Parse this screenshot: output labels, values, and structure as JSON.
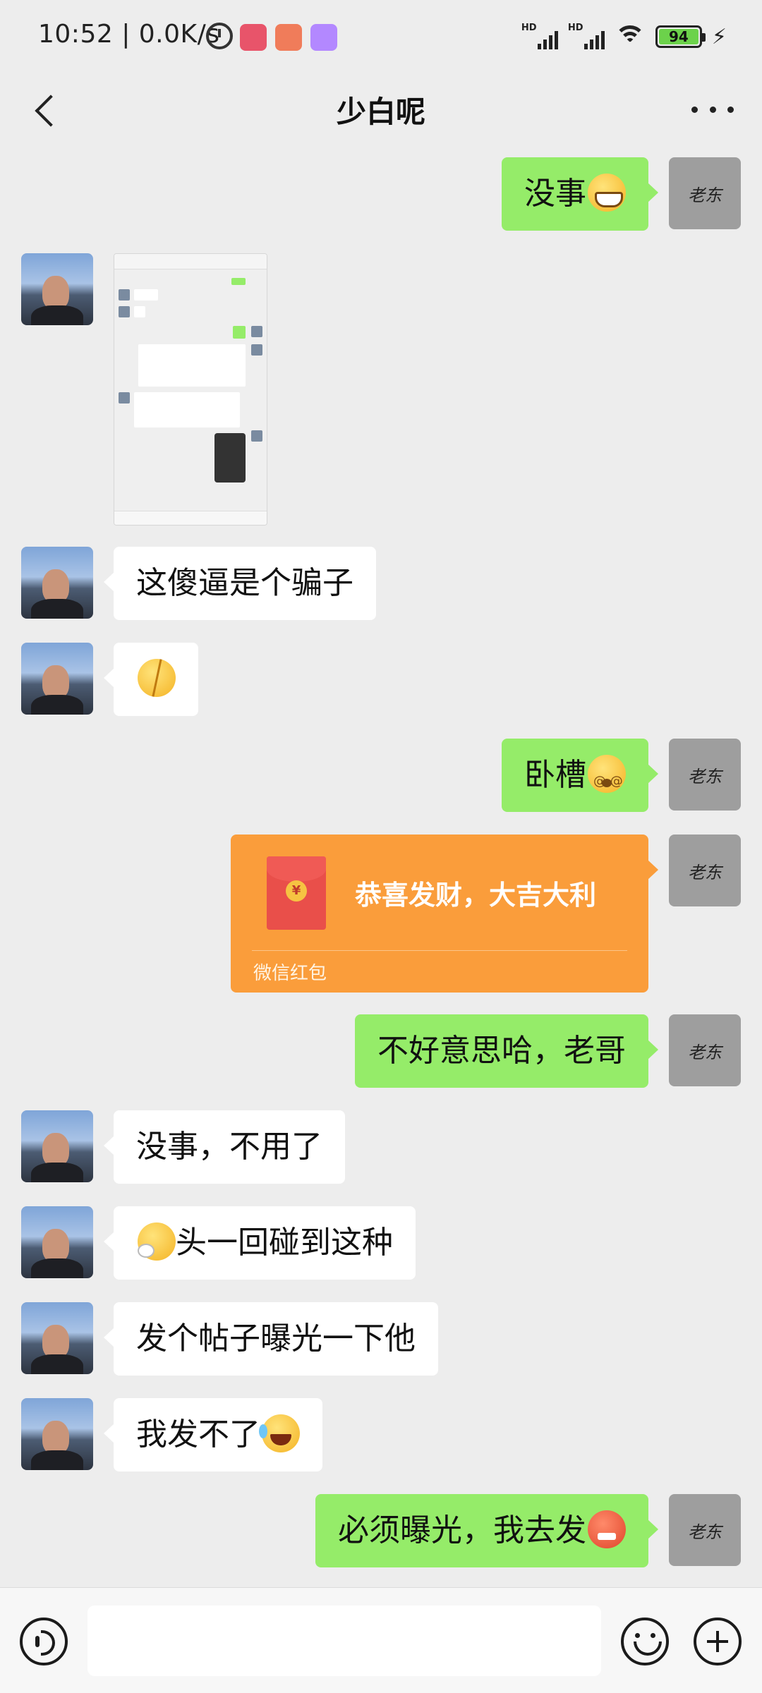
{
  "status_bar": {
    "time_speed": "10:52 | 0.0K/s",
    "signal1_label": "HD",
    "signal2_label": "HD",
    "battery": "94",
    "icons": [
      "alarm-icon",
      "app-notification-icon",
      "app-notification-icon",
      "app-notification-icon",
      "signal-icon",
      "signal-icon",
      "wifi-icon",
      "battery-icon",
      "charging-icon"
    ]
  },
  "nav": {
    "title": "少白呢",
    "back_icon": "chevron-left-icon",
    "more_icon": "more-dots-icon"
  },
  "self_avatar_text": "老东",
  "messages": [
    {
      "from": "self",
      "text": "没事",
      "emoji": "grin"
    },
    {
      "from": "other",
      "type": "image",
      "content": "screenshot"
    },
    {
      "from": "other",
      "text": "这傻逼是个骗子"
    },
    {
      "from": "other",
      "text": "",
      "emoji": "cracked-face"
    },
    {
      "from": "self",
      "text": "卧槽",
      "emoji": "dizzy"
    },
    {
      "from": "self",
      "type": "red_packet",
      "text": "恭喜发财，大吉大利",
      "footer": "微信红包"
    },
    {
      "from": "self",
      "text": "不好意思哈，老哥"
    },
    {
      "from": "other",
      "text": "没事，不用了"
    },
    {
      "from": "other",
      "text": "头一回碰到这种",
      "emoji": "sigh"
    },
    {
      "from": "other",
      "text": "发个帖子曝光一下他"
    },
    {
      "from": "other",
      "text": "我发不了",
      "emoji": "tears-of-joy"
    },
    {
      "from": "self",
      "text": "必须曝光，我去发",
      "emoji": "angry"
    }
  ],
  "input_bar": {
    "voice_icon": "voice-icon",
    "emoji_icon": "emoji-icon",
    "plus_icon": "plus-icon",
    "input_value": ""
  },
  "colors": {
    "background": "#EDEDED",
    "self_bubble": "#95EC69",
    "other_bubble": "#FFFFFF",
    "red_packet": "#FA9D3B"
  }
}
